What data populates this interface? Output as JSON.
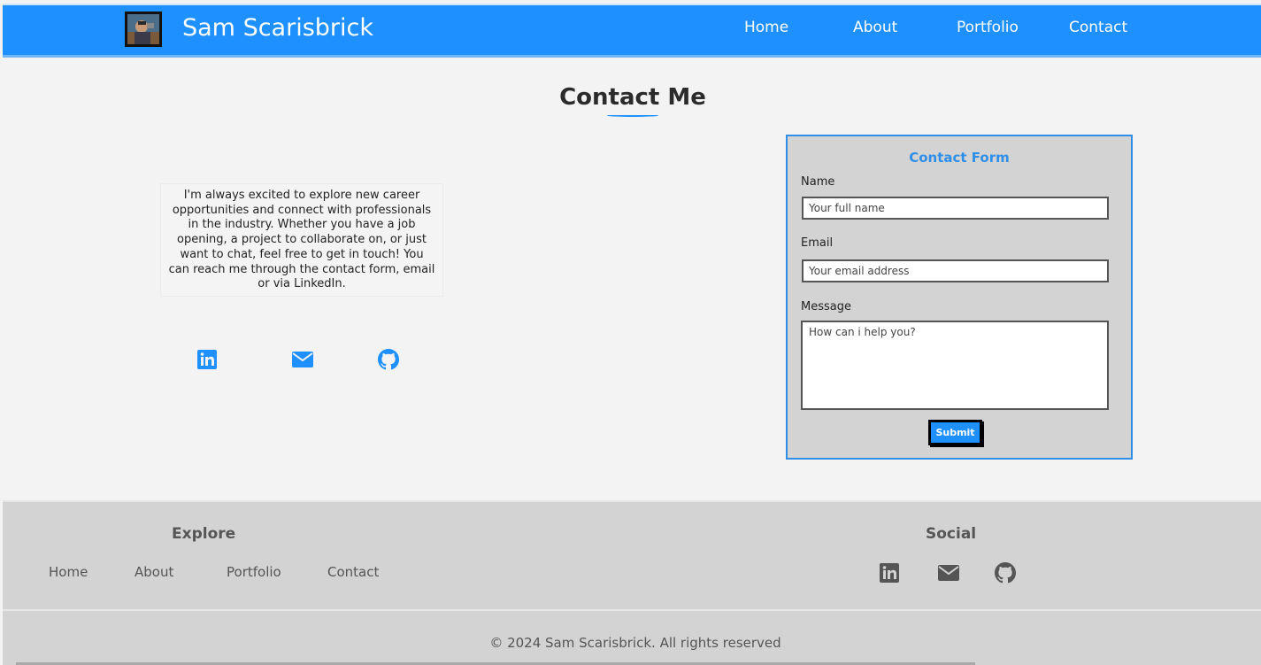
{
  "header": {
    "brand": "Sam Scarisbrick",
    "nav": [
      "Home",
      "About",
      "Portfolio",
      "Contact"
    ]
  },
  "main": {
    "title": "Contact Me",
    "intro": "I'm always excited to explore new career opportunities and connect with professionals in the industry. Whether you have a job opening, a project to collaborate on, or just want to chat, feel free to get in touch! You can reach me through the contact form, email or via LinkedIn.",
    "social_icons": [
      "linkedin-icon",
      "envelope-icon",
      "github-icon"
    ]
  },
  "form": {
    "title": "Contact Form",
    "name_label": "Name",
    "name_placeholder": "Your full name",
    "email_label": "Email",
    "email_placeholder": "Your email address",
    "message_label": "Message",
    "message_placeholder": "How can i help you?",
    "submit_label": "Submit"
  },
  "footer": {
    "explore_heading": "Explore",
    "links": [
      "Home",
      "About",
      "Portfolio",
      "Contact"
    ],
    "social_heading": "Social",
    "social_icons": [
      "linkedin-icon",
      "envelope-icon",
      "github-icon"
    ],
    "copyright": "© 2024 Sam Scarisbrick. All rights reserved"
  },
  "colors": {
    "primary": "#1e90ff",
    "footer_bg": "#d3d3d3",
    "page_bg": "#f3f3f3"
  }
}
